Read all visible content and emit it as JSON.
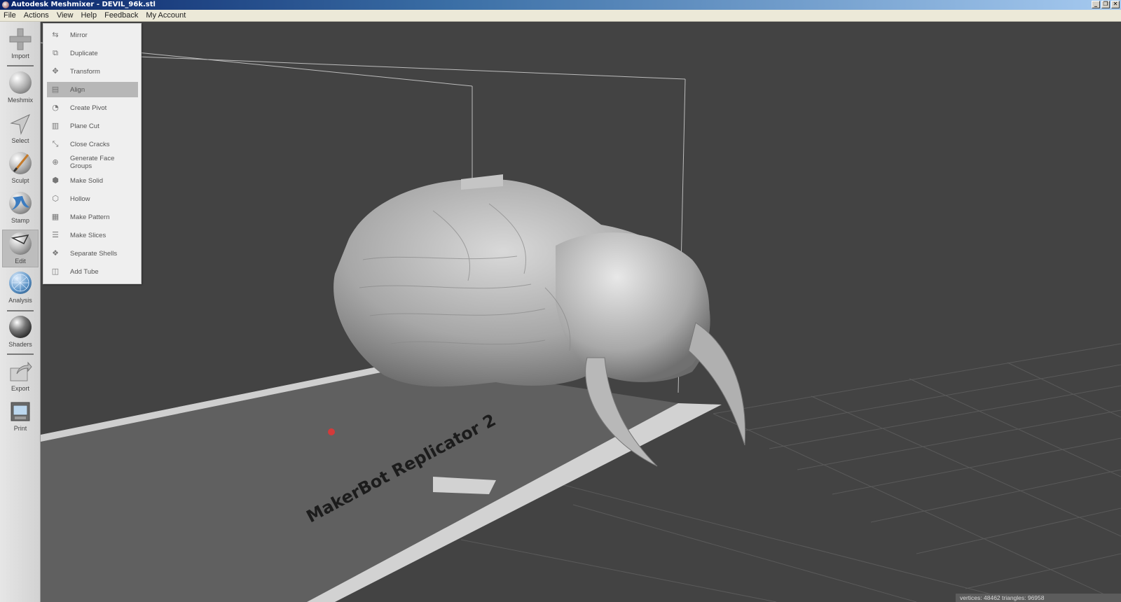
{
  "window": {
    "title": "Autodesk Meshmixer - DEVIL_96k.stl",
    "controls": [
      "_",
      "❐",
      "✕"
    ]
  },
  "menubar": [
    "File",
    "Actions",
    "View",
    "Help",
    "Feedback",
    "My Account"
  ],
  "toolbar": [
    {
      "label": "Import",
      "icon": "plus-icon"
    },
    {
      "label": "Meshmix",
      "icon": "meshmix-icon"
    },
    {
      "label": "Select",
      "icon": "select-arrow-icon"
    },
    {
      "label": "Sculpt",
      "icon": "sculpt-brush-icon"
    },
    {
      "label": "Stamp",
      "icon": "stamp-icon"
    },
    {
      "label": "Edit",
      "icon": "edit-icon",
      "active": true
    },
    {
      "label": "Analysis",
      "icon": "analysis-icon"
    },
    {
      "label": "Shaders",
      "icon": "shader-sphere-icon"
    },
    {
      "label": "Export",
      "icon": "export-icon"
    },
    {
      "label": "Print",
      "icon": "print-icon"
    }
  ],
  "edit_menu": [
    {
      "label": "Mirror",
      "icon": "mirror-icon"
    },
    {
      "label": "Duplicate",
      "icon": "duplicate-icon"
    },
    {
      "label": "Transform",
      "icon": "transform-icon"
    },
    {
      "label": "Align",
      "icon": "align-icon",
      "highlighted": true
    },
    {
      "label": "Create Pivot",
      "icon": "pivot-icon"
    },
    {
      "label": "Plane Cut",
      "icon": "plane-cut-icon"
    },
    {
      "label": "Close Cracks",
      "icon": "close-cracks-icon"
    },
    {
      "label": "Generate Face Groups",
      "icon": "face-groups-icon"
    },
    {
      "label": "Make Solid",
      "icon": "make-solid-icon"
    },
    {
      "label": "Hollow",
      "icon": "hollow-icon"
    },
    {
      "label": "Make Pattern",
      "icon": "pattern-icon"
    },
    {
      "label": "Make Slices",
      "icon": "slices-icon"
    },
    {
      "label": "Separate Shells",
      "icon": "shells-icon"
    },
    {
      "label": "Add Tube",
      "icon": "tube-icon"
    }
  ],
  "viewport": {
    "printer_label": "MakerBot Replicator 2",
    "status": "vertices: 48462 triangles: 96958"
  }
}
